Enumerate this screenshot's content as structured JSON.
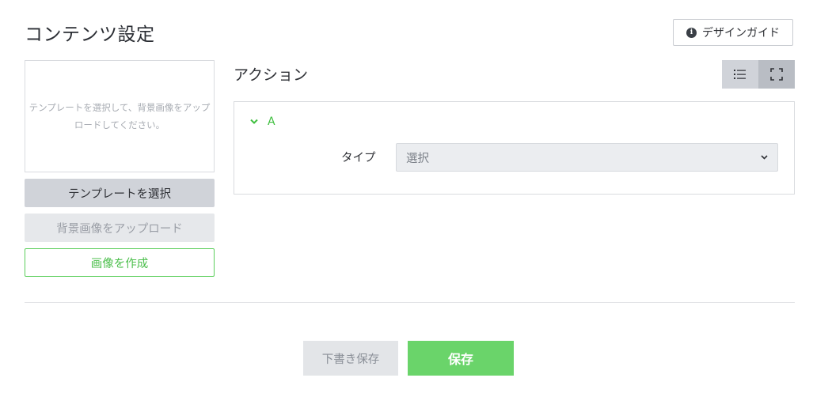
{
  "header": {
    "title": "コンテンツ設定",
    "design_guide_label": "デザインガイド",
    "design_guide_icon": "info-icon"
  },
  "left_panel": {
    "preview_hint": "テンプレートを選択して、背景画像をアップロードしてください。",
    "select_template_label": "テンプレートを選択",
    "upload_background_label": "背景画像をアップロード",
    "create_image_label": "画像を作成"
  },
  "action_section": {
    "title": "アクション",
    "view_toggle": [
      {
        "icon": "list-icon",
        "active": false
      },
      {
        "icon": "fullscreen-icon",
        "active": true
      }
    ],
    "items": [
      {
        "label": "A",
        "expanded": true,
        "type_label": "タイプ",
        "type_value": "選択"
      }
    ]
  },
  "footer": {
    "draft_label": "下書き保存",
    "save_label": "保存"
  },
  "colors": {
    "accent_green": "#6ad46a",
    "green_text": "#3fbf3f",
    "border": "#d9dbdf"
  }
}
